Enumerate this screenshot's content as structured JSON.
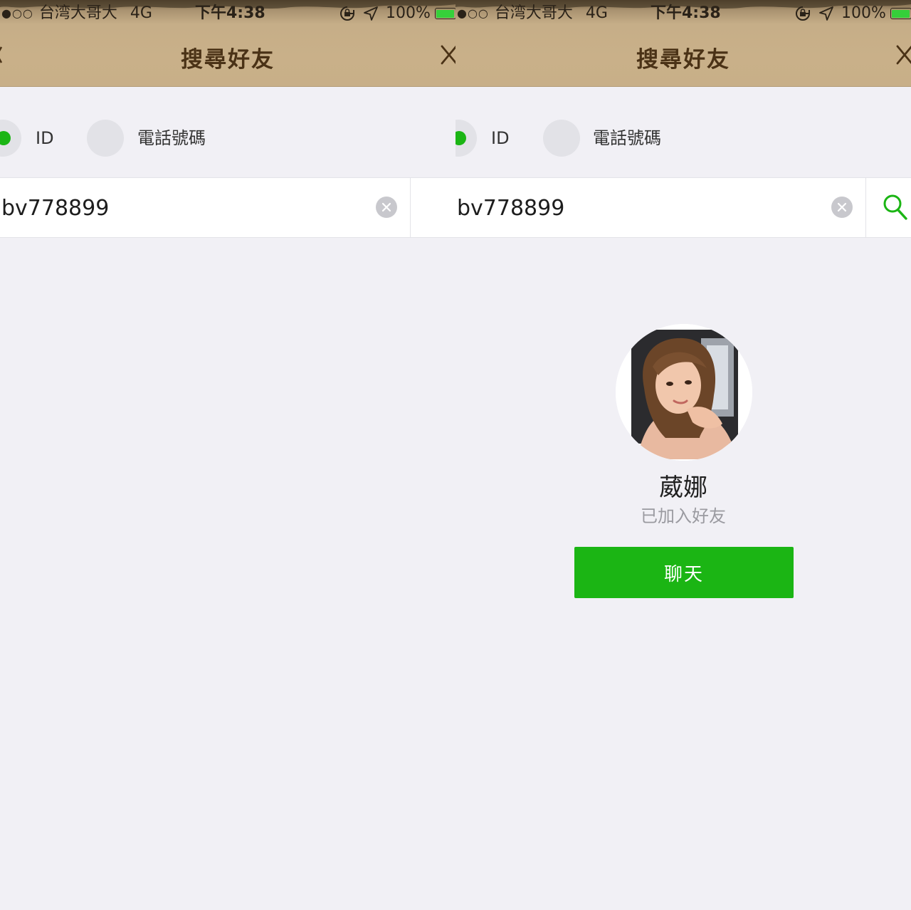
{
  "status_bar": {
    "signal": "●○○",
    "carrier": "台湾大哥大",
    "network": "4G",
    "time": "下午4:38",
    "battery": "100%"
  },
  "header": {
    "title": "搜尋好友"
  },
  "search_type": {
    "options": [
      {
        "label": "ID",
        "selected": true
      },
      {
        "label": "電話號碼",
        "selected": false
      }
    ]
  },
  "search": {
    "value": "bv778899"
  },
  "result": {
    "name": "葳娜",
    "status": "已加入好友",
    "chat_button": "聊天"
  },
  "colors": {
    "accent_green": "#1bb514",
    "header_tan": "#c9b089",
    "title_brown": "#4a3216",
    "background": "#f1f0f5"
  }
}
